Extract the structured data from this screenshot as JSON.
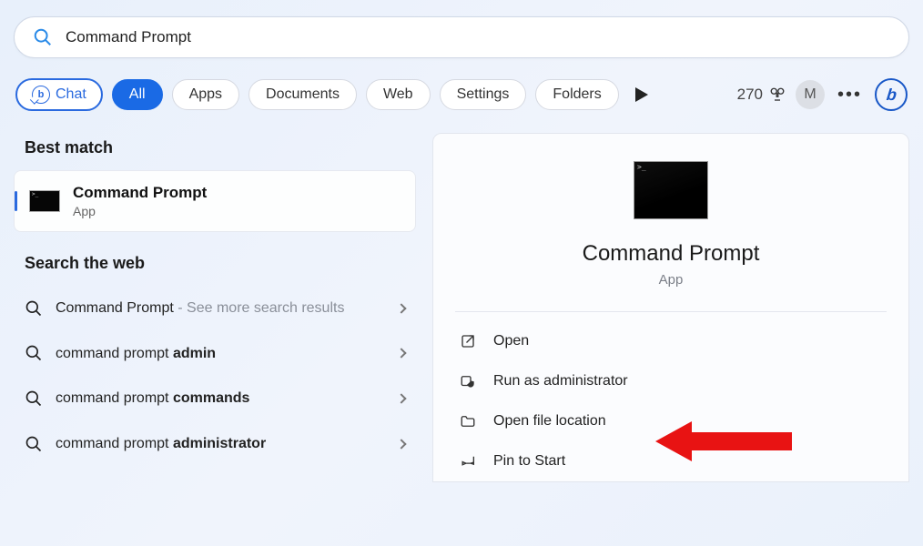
{
  "search": {
    "value": "Command Prompt"
  },
  "filters": {
    "chat": "Chat",
    "tabs": [
      "All",
      "Apps",
      "Documents",
      "Web",
      "Settings",
      "Folders"
    ]
  },
  "header": {
    "points": "270",
    "avatar_initial": "M"
  },
  "left": {
    "best_match_heading": "Best match",
    "best_match": {
      "title": "Command Prompt",
      "subtitle": "App"
    },
    "web_heading": "Search the web",
    "web_items": [
      {
        "prefix": "",
        "main": "Command Prompt",
        "suffix_dim": " - See more search results",
        "bold_suffix": ""
      },
      {
        "prefix": "command prompt ",
        "main": "",
        "suffix_dim": "",
        "bold_suffix": "admin"
      },
      {
        "prefix": "command prompt ",
        "main": "",
        "suffix_dim": "",
        "bold_suffix": "commands"
      },
      {
        "prefix": "command prompt ",
        "main": "",
        "suffix_dim": "",
        "bold_suffix": "administrator"
      }
    ]
  },
  "preview": {
    "title": "Command Prompt",
    "subtitle": "App",
    "actions": [
      {
        "icon": "open",
        "label": "Open"
      },
      {
        "icon": "admin",
        "label": "Run as administrator"
      },
      {
        "icon": "folder",
        "label": "Open file location"
      },
      {
        "icon": "pin",
        "label": "Pin to Start"
      }
    ]
  }
}
